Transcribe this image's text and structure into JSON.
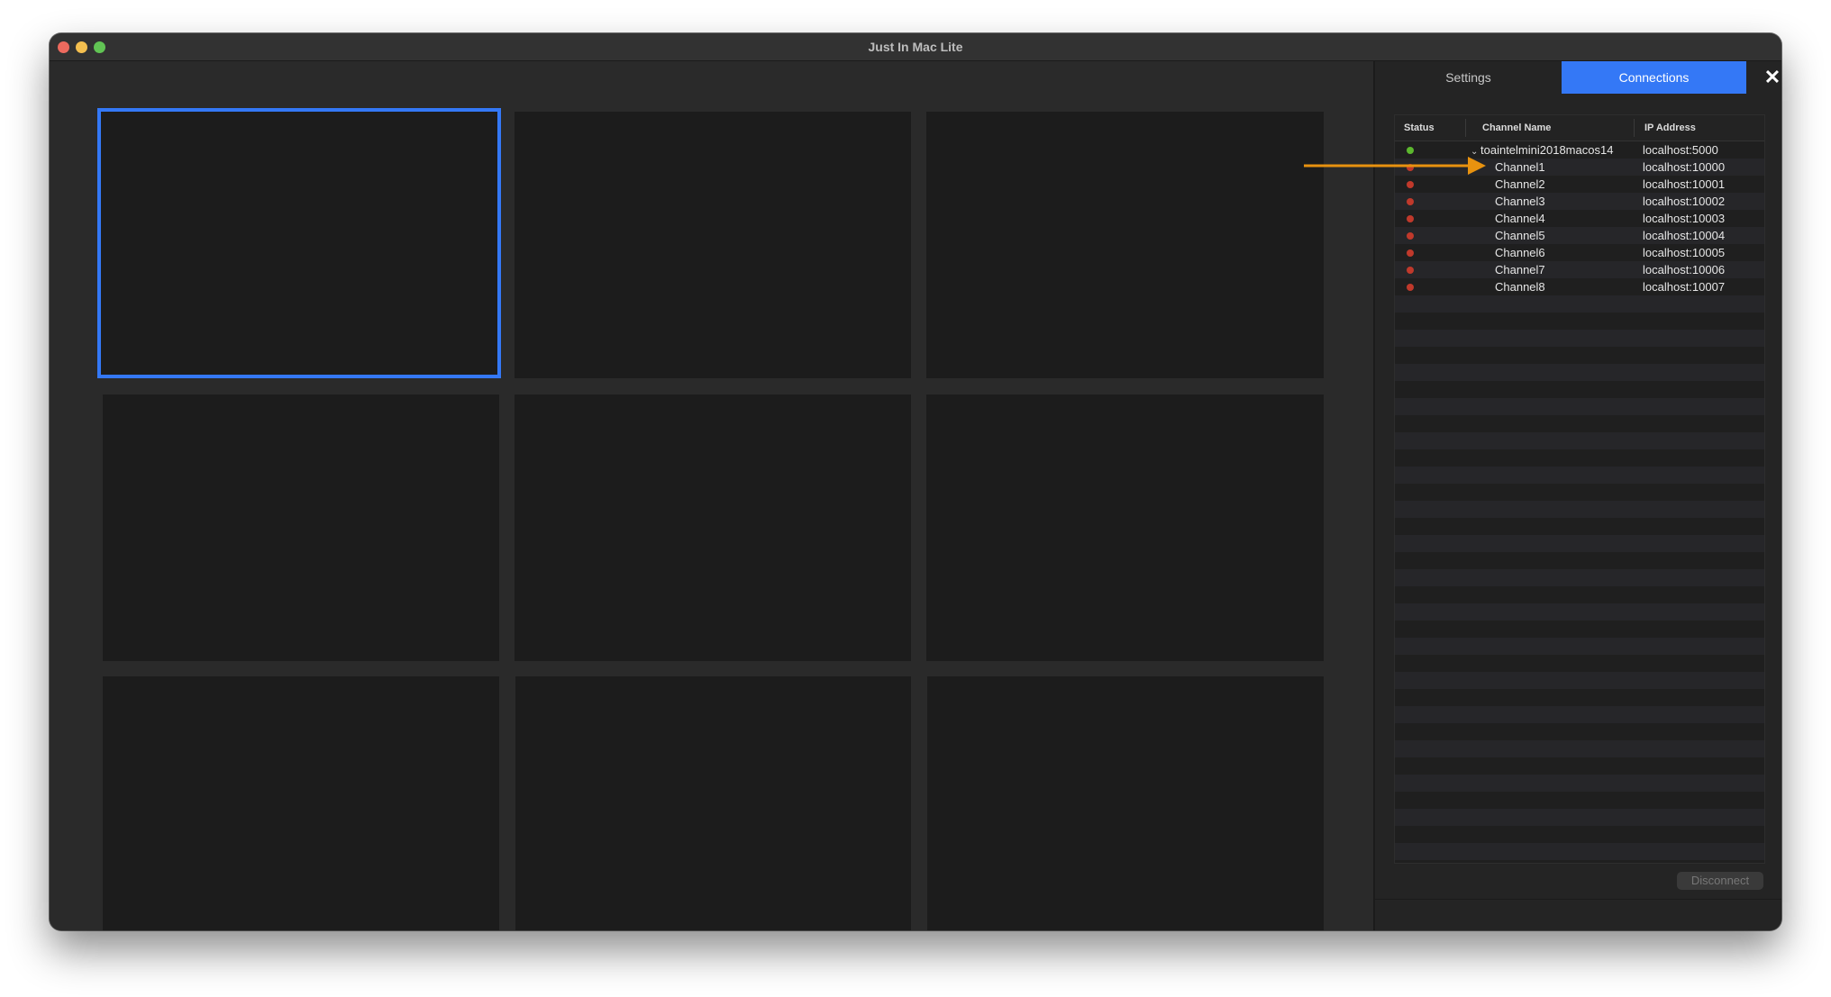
{
  "window": {
    "title": "Just In Mac Lite"
  },
  "tabs": {
    "settings": "Settings",
    "connections": "Connections",
    "close_symbol": "✕"
  },
  "table": {
    "headers": {
      "status": "Status",
      "channel_name": "Channel Name",
      "ip_address": "IP Address"
    },
    "rows": [
      {
        "status": "connected",
        "name": "toaintelmini2018macos14",
        "ip": "localhost:5000",
        "expandable": true
      },
      {
        "status": "disconnected",
        "name": "Channel1",
        "ip": "localhost:10000"
      },
      {
        "status": "disconnected",
        "name": "Channel2",
        "ip": "localhost:10001"
      },
      {
        "status": "disconnected",
        "name": "Channel3",
        "ip": "localhost:10002"
      },
      {
        "status": "disconnected",
        "name": "Channel4",
        "ip": "localhost:10003"
      },
      {
        "status": "disconnected",
        "name": "Channel5",
        "ip": "localhost:10004"
      },
      {
        "status": "disconnected",
        "name": "Channel6",
        "ip": "localhost:10005"
      },
      {
        "status": "disconnected",
        "name": "Channel7",
        "ip": "localhost:10006"
      },
      {
        "status": "disconnected",
        "name": "Channel8",
        "ip": "localhost:10007"
      }
    ],
    "status_colors": {
      "connected": "#5cb82e",
      "disconnected": "#c0392b"
    }
  },
  "disconnect_button": {
    "label": "Disconnect",
    "enabled": false
  },
  "grid": {
    "rows": 3,
    "columns": 3,
    "selected_index": 0
  },
  "icons": {
    "annotation": "arrow-right-icon",
    "expand": "chevron-down-icon"
  },
  "colors": {
    "accent": "#3478f6",
    "annotation_arrow": "#e8920f"
  }
}
